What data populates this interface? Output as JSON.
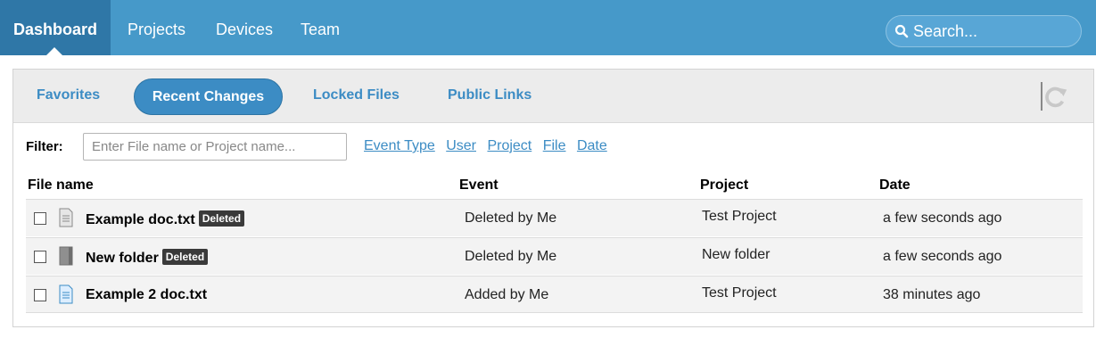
{
  "nav": {
    "items": [
      {
        "label": "Dashboard"
      },
      {
        "label": "Projects"
      },
      {
        "label": "Devices"
      },
      {
        "label": "Team"
      }
    ],
    "search_placeholder": "Search..."
  },
  "tabs": {
    "items": [
      {
        "label": "Favorites"
      },
      {
        "label": "Recent Changes"
      },
      {
        "label": "Locked Files"
      },
      {
        "label": "Public Links"
      }
    ],
    "active": "Recent Changes"
  },
  "filter": {
    "label": "Filter:",
    "placeholder": "Enter File name or Project name...",
    "links": [
      "Event Type",
      "User",
      "Project",
      "File",
      "Date"
    ]
  },
  "table": {
    "headers": [
      "File name",
      "Event",
      "Project",
      "Date"
    ],
    "rows": [
      {
        "file": "Example doc.txt",
        "badge": "Deleted",
        "icon": "document-gray-icon",
        "event": "Deleted by Me",
        "project": "Test Project",
        "date": "a few seconds ago"
      },
      {
        "file": "New folder",
        "badge": "Deleted",
        "icon": "folder-gray-icon",
        "event": "Deleted by Me",
        "project": "New folder",
        "date": "a few seconds ago"
      },
      {
        "file": "Example 2 doc.txt",
        "badge": "",
        "icon": "document-blue-icon",
        "event": "Added by Me",
        "project": "Test Project",
        "date": "38 minutes ago"
      }
    ]
  },
  "colors": {
    "topbar": "#4699c9",
    "active_nav": "#2f77a7",
    "accent": "#3c8cc4",
    "badge": "#3a3a3a"
  }
}
